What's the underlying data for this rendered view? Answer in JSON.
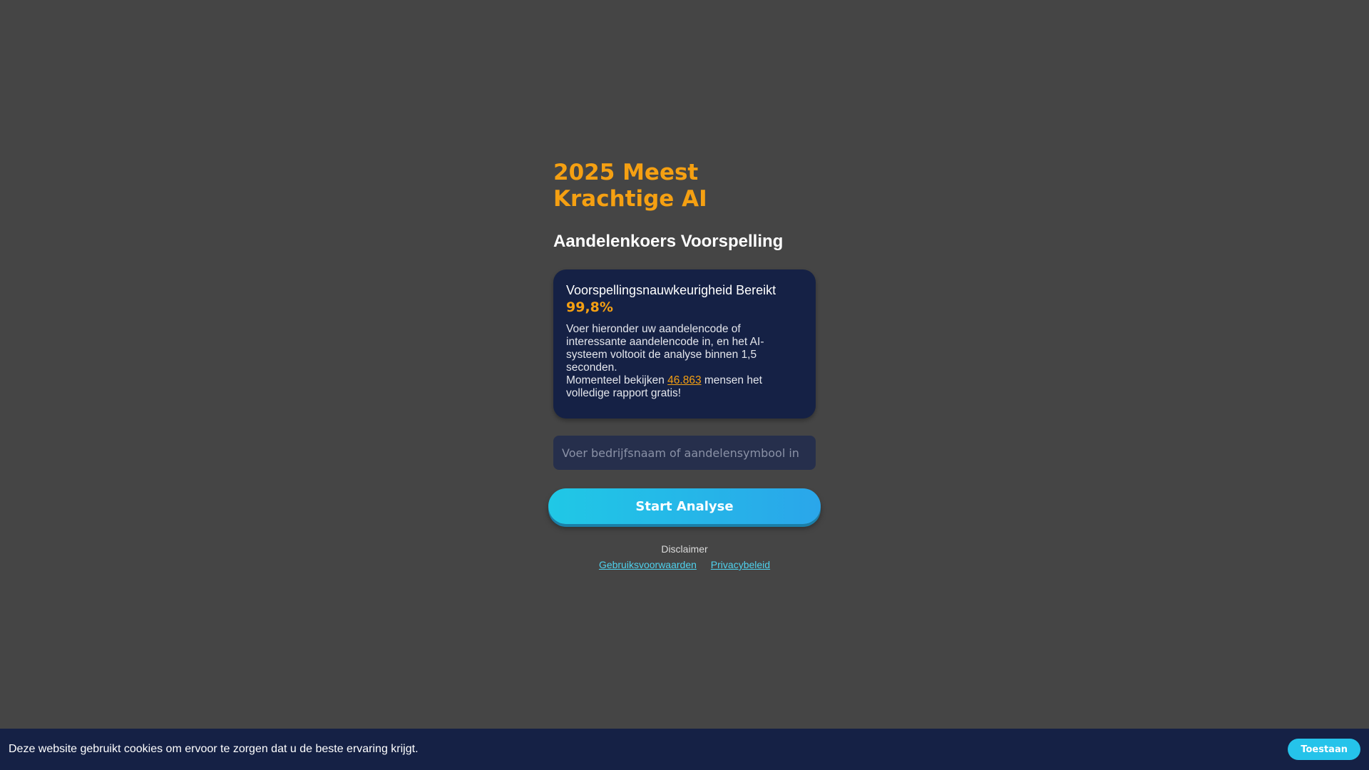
{
  "hero": {
    "title": "2025 Meest Krachtige AI",
    "subtitle": "Aandelenkoers Voorspelling"
  },
  "card": {
    "heading": "Voorspellingsnauwkeurigheid Bereikt",
    "accuracy": "99,8%",
    "description": "Voer hieronder uw aandelencode of interessante aandelencode in, en het AI-systeem voltooit de analyse binnen 1,5 seconden.",
    "viewers_prefix": "Momenteel bekijken ",
    "viewers_count": "46.863",
    "viewers_suffix": " mensen het volledige rapport gratis!"
  },
  "search": {
    "placeholder": "Voer bedrijfsnaam of aandelensymbool in",
    "value": ""
  },
  "actions": {
    "start_label": "Start Analyse"
  },
  "footer": {
    "disclaimer": "Disclaimer",
    "terms_link": "Gebruiksvoorwaarden",
    "privacy_link": "Privacybeleid"
  },
  "cookie": {
    "message": "Deze website gebruikt cookies om ervoor te zorgen dat u de beste ervaring krijgt.",
    "accept_label": "Toestaan"
  },
  "colors": {
    "background": "#454545",
    "accent_orange": "#f5a012",
    "card_navy": "#152145",
    "button_cyan": "#25c3ea",
    "link_cyan": "#4fd2ee"
  }
}
